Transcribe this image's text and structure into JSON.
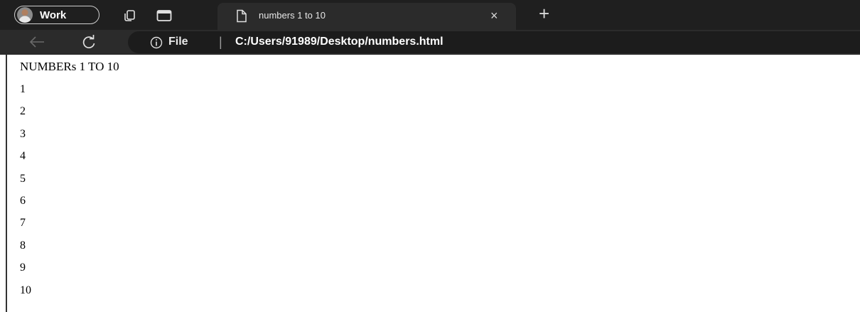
{
  "browser": {
    "profile_label": "Work",
    "tab": {
      "title": "numbers 1 to 10",
      "close_glyph": "×"
    },
    "new_tab_glyph": "+",
    "address": {
      "info_label": "File",
      "separator": "|",
      "url": "C:/Users/91989/Desktop/numbers.html"
    },
    "icons": [
      "avatar",
      "workspaces-icon",
      "vertical-tabs-icon",
      "page-icon",
      "back-icon",
      "refresh-icon",
      "info-icon"
    ]
  },
  "page": {
    "heading": "NUMBERs 1 TO 10",
    "numbers": [
      "1",
      "2",
      "3",
      "4",
      "5",
      "6",
      "7",
      "8",
      "9",
      "10"
    ]
  }
}
